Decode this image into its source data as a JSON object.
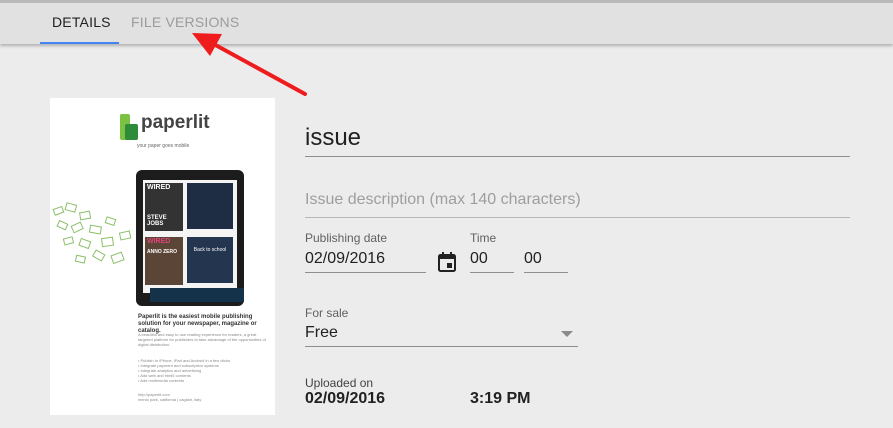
{
  "tabs": {
    "details": "DETAILS",
    "file_versions": "FILE VERSIONS"
  },
  "thumbnail": {
    "logo": "paperlit",
    "tagline": "your paper goes mobile",
    "magazine_1": "WIRED",
    "magazine_1_cover": "STEVE JOBS",
    "magazine_2": "WIRED",
    "magazine_2_cover": "ANNO ZERO",
    "magazine_2_text": "Back to school",
    "headline": "Paperlit is the easiest mobile publishing solution for your newspaper, magazine or catalog.",
    "body": "A beautiful and easy to use reading experience for readers, a great targeted platform for publishers to take advantage of the opportunities of digital distribution.",
    "bullets": [
      "• Publish to iPhone, iPad and Android in a few clicks",
      "• Integrate payment and subscription systems",
      "• Integrate analytics and advertising",
      "• Add web and html5 contents",
      "• Add multimedia contents"
    ],
    "footer_url": "http://paperlit.com",
    "footer_address": "menlo park, california | cagliari, italy"
  },
  "form": {
    "title_value": "issue",
    "description_placeholder": "Issue description (max 140 characters)",
    "publishing_date_label": "Publishing date",
    "publishing_date_value": "02/09/2016",
    "time_label": "Time",
    "hour_value": "00",
    "minute_value": "00",
    "for_sale_label": "For sale",
    "for_sale_value": "Free",
    "uploaded_label": "Uploaded on",
    "uploaded_date": "02/09/2016",
    "uploaded_time": "3:19 PM"
  },
  "colors": {
    "tab_indicator": "#4285f4",
    "annotation_arrow": "#ee1c1c",
    "logo_green": "#7cc242"
  },
  "icons": [
    "calendar-icon",
    "dropdown-arrow-icon",
    "annotation-arrow"
  ]
}
